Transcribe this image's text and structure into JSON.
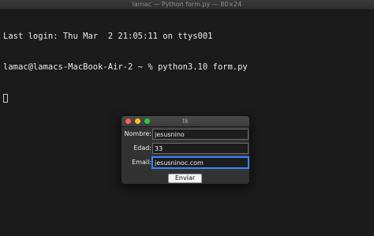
{
  "terminal": {
    "title": "lamac — Python form.py — 80×24",
    "lines": [
      "Last login: Thu Mar  2 21:05:11 on ttys001",
      "lamac@lamacs-MacBook-Air-2 ~ % python3.10 form.py"
    ]
  },
  "tk": {
    "title": "tk",
    "fields": [
      {
        "label": "Nombre:",
        "value": "jesusnino"
      },
      {
        "label": "Edad:",
        "value": "33"
      },
      {
        "label": "Email:",
        "value": "jesusninoc.com"
      }
    ],
    "submit_label": "Enviar"
  },
  "colors": {
    "terminal_bg": "#1b1b1b",
    "window_bg": "#323232",
    "focus_ring": "#3a86ff",
    "close": "#fe5f57",
    "minimize": "#febc2e",
    "maximize": "#28c840"
  },
  "icons": [
    "close-button",
    "minimize-button",
    "maximize-button"
  ]
}
